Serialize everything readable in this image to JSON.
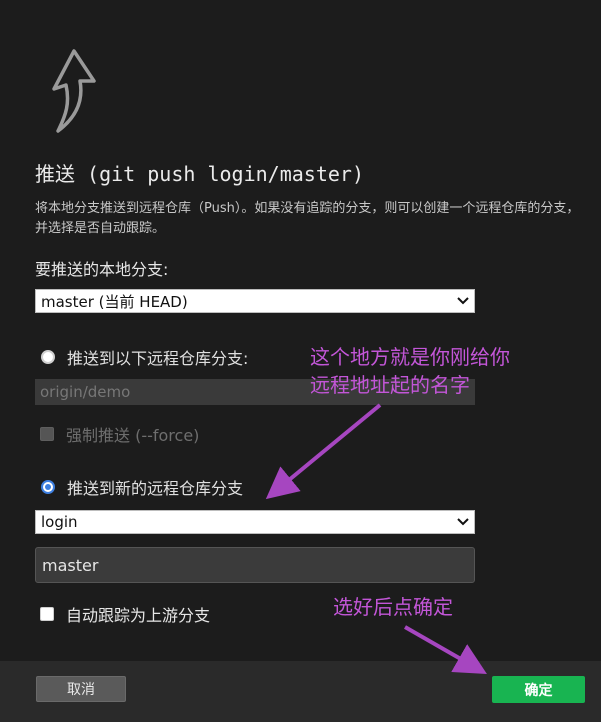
{
  "dialog": {
    "title": "推送 (git push login/master)",
    "description": "将本地分支推送到远程仓库（Push）。如果没有追踪的分支，则可以创建一个远程仓库的分支，并选择是否自动跟踪。",
    "local_branch_label": "要推送的本地分支:",
    "local_branch_value": "master (当前 HEAD)",
    "push_to_existing_label": "推送到以下远程仓库分支:",
    "existing_remote_branch": "origin/demo",
    "force_label": "强制推送 (--force)",
    "push_to_new_label": "推送到新的远程仓库分支",
    "new_remote_value": "login",
    "target_branch_value": "master",
    "track_upstream_label": "自动跟踪为上游分支",
    "cancel_label": "取消",
    "ok_label": "确定"
  },
  "annotations": {
    "remote_name_line1": "这个地方就是你刚给你",
    "remote_name_line2": "远程地址起的名字",
    "confirm_note": "选好后点确定"
  },
  "colors": {
    "background": "#1c1c1c",
    "ok_button": "#18b451",
    "radio_selected": "#3d7fe0",
    "annotation": "#c356d8"
  },
  "icons": {
    "header": "push-arrow-icon",
    "dropdown": "chevron-down-icon"
  }
}
